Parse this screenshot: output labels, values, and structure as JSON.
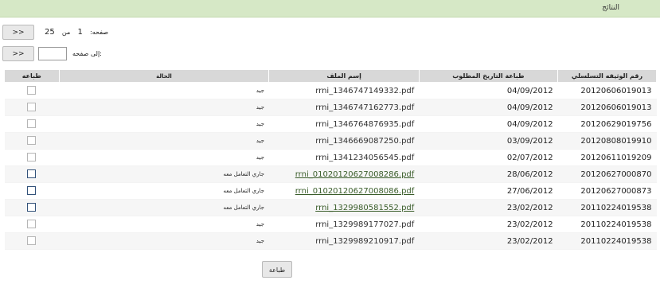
{
  "results": {
    "title": "النتائج"
  },
  "pager": {
    "next_label": ">>",
    "page_label": "صفحه:",
    "current_page": "1",
    "of_label": "من",
    "total_pages": "25",
    "goto_label": "إلى صفحه:",
    "goto_value": "",
    "go_label": ">>"
  },
  "table": {
    "headers": {
      "serial": "رقم الوثيقه التسلسلي",
      "date": "طباعة التاريخ المطلوب",
      "file": "إسم الملف",
      "status": "الحالة",
      "print": "طباعه"
    },
    "rows": [
      {
        "serial": "20120606019013",
        "date": "04/09/2012",
        "file": "rrni_1346747149332.pdf",
        "status": "جيد",
        "link": false
      },
      {
        "serial": "20120606019013",
        "date": "04/09/2012",
        "file": "rrni_1346747162773.pdf",
        "status": "جيد",
        "link": false
      },
      {
        "serial": "20120629019756",
        "date": "04/09/2012",
        "file": "rrni_1346764876935.pdf",
        "status": "جيد",
        "link": false
      },
      {
        "serial": "20120808019910",
        "date": "03/09/2012",
        "file": "rrni_1346669087250.pdf",
        "status": "جيد",
        "link": false
      },
      {
        "serial": "20120611019209",
        "date": "02/07/2012",
        "file": "rrni_1341234056545.pdf",
        "status": "جيد",
        "link": false
      },
      {
        "serial": "20120627000870",
        "date": "28/06/2012",
        "file": "rrni_01020120627008286.pdf",
        "status": "جاري التعامل معه",
        "link": true
      },
      {
        "serial": "20120627000873",
        "date": "27/06/2012",
        "file": "rrni_01020120627008086.pdf",
        "status": "جاري التعامل معه",
        "link": true
      },
      {
        "serial": "20110224019538",
        "date": "23/02/2012",
        "file": "rrni_1329980581552.pdf",
        "status": "جاري التعامل معه",
        "link": true
      },
      {
        "serial": "20110224019538",
        "date": "23/02/2012",
        "file": "rrni_1329989177027.pdf",
        "status": "جيد",
        "link": false
      },
      {
        "serial": "20110224019538",
        "date": "23/02/2012",
        "file": "rrni_1329989210917.pdf",
        "status": "جيد",
        "link": false
      }
    ]
  },
  "actions": {
    "print_label": "طباعة"
  }
}
